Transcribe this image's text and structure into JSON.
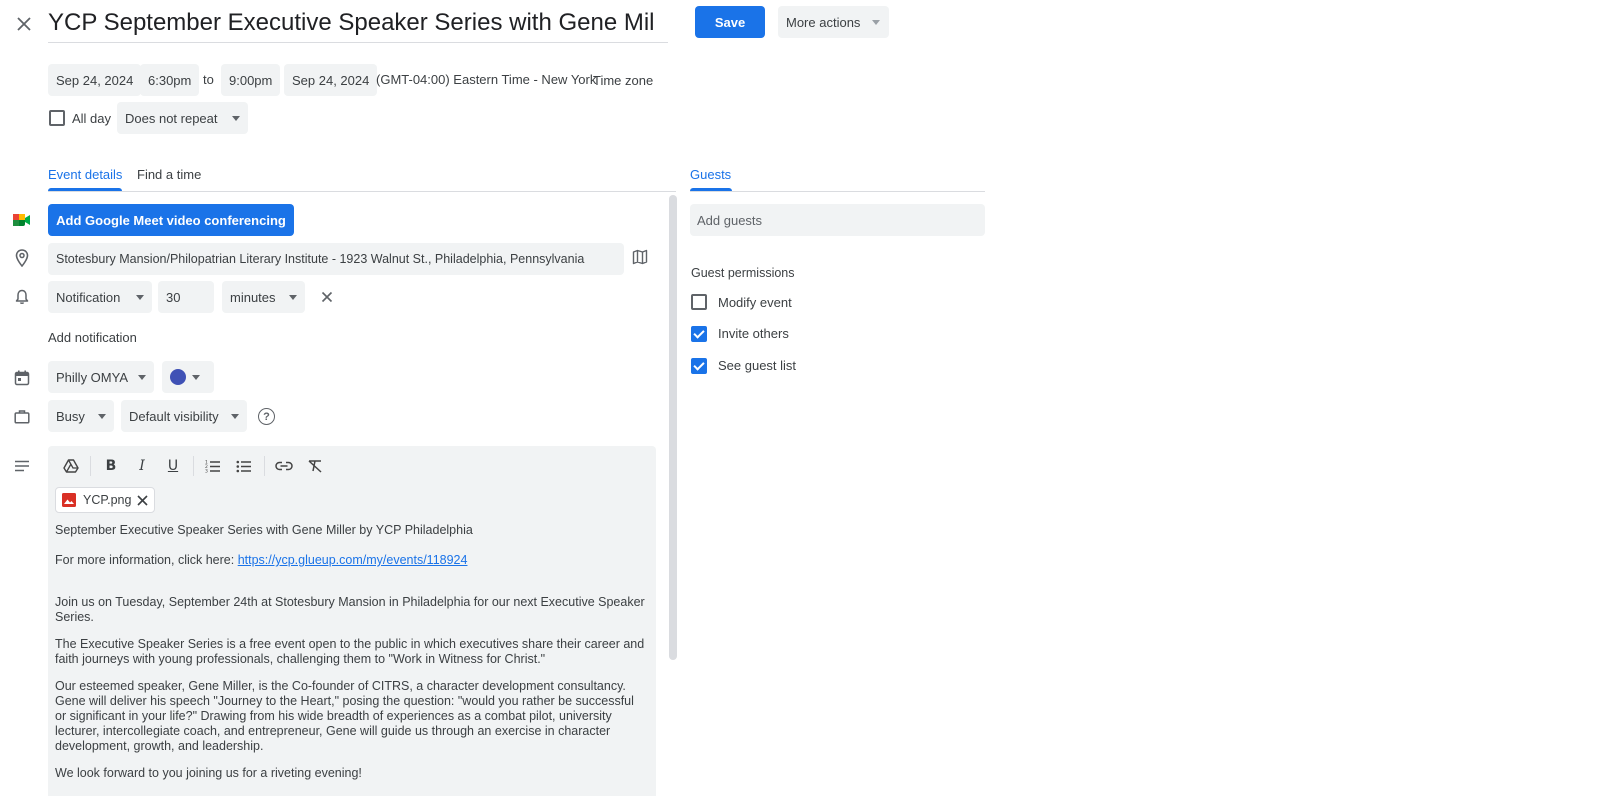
{
  "header": {
    "title": "YCP September Executive Speaker Series with Gene Mil",
    "save_label": "Save",
    "more_actions_label": "More actions"
  },
  "datetime": {
    "start_date": "Sep 24, 2024",
    "start_time": "6:30pm",
    "to_label": "to",
    "end_time": "9:00pm",
    "end_date": "Sep 24, 2024",
    "timezone_value": "(GMT-04:00) Eastern Time - New York",
    "timezone_button": "Time zone",
    "all_day_label": "All day",
    "repeat_value": "Does not repeat"
  },
  "tabs": {
    "event_details": "Event details",
    "find_time": "Find a time"
  },
  "details": {
    "meet_button": "Add Google Meet video conferencing",
    "location": "Stotesbury Mansion/Philopatrian Literary Institute - 1923 Walnut St., Philadelphia, Pennsylvania",
    "notification_type": "Notification",
    "notification_amount": "30",
    "notification_unit": "minutes",
    "add_notification": "Add notification",
    "calendar_name": "Philly OMYA",
    "calendar_color": "#3f51b5",
    "availability": "Busy",
    "visibility": "Default visibility"
  },
  "description": {
    "attachment_name": "YCP.png",
    "line1": "September Executive Speaker Series with Gene Miller by YCP Philadelphia",
    "line2_prefix": "For more information, click here: ",
    "line2_link": "https://ycp.glueup.com/my/events/118924",
    "para1": "Join us on Tuesday, September 24th at Stotesbury Mansion in Philadelphia for our next Executive Speaker Series.",
    "para2": "The Executive Speaker Series is a free event open to the public in which executives share their career and faith journeys with young professionals, challenging them to \"Work in Witness for Christ.\"",
    "para3": "Our esteemed speaker, Gene Miller, is the Co-founder of CITRS, a character development consultancy. Gene will deliver his speech \"Journey to the Heart,\" posing the question: \"would you rather be successful or significant in your life?\" Drawing from his wide breadth of experiences as a combat pilot, university lecturer, intercollegiate coach, and entrepreneur, Gene will guide us through an exercise in character development, growth, and leadership.",
    "para4": "We look forward to you joining us for a riveting evening!"
  },
  "guests": {
    "tab_label": "Guests",
    "add_placeholder": "Add guests",
    "permissions_label": "Guest permissions",
    "permissions": [
      {
        "label": "Modify event",
        "checked": false
      },
      {
        "label": "Invite others",
        "checked": true
      },
      {
        "label": "See guest list",
        "checked": true
      }
    ]
  },
  "colors": {
    "accent": "#1a73e8",
    "chip_bg": "#f1f3f4"
  }
}
